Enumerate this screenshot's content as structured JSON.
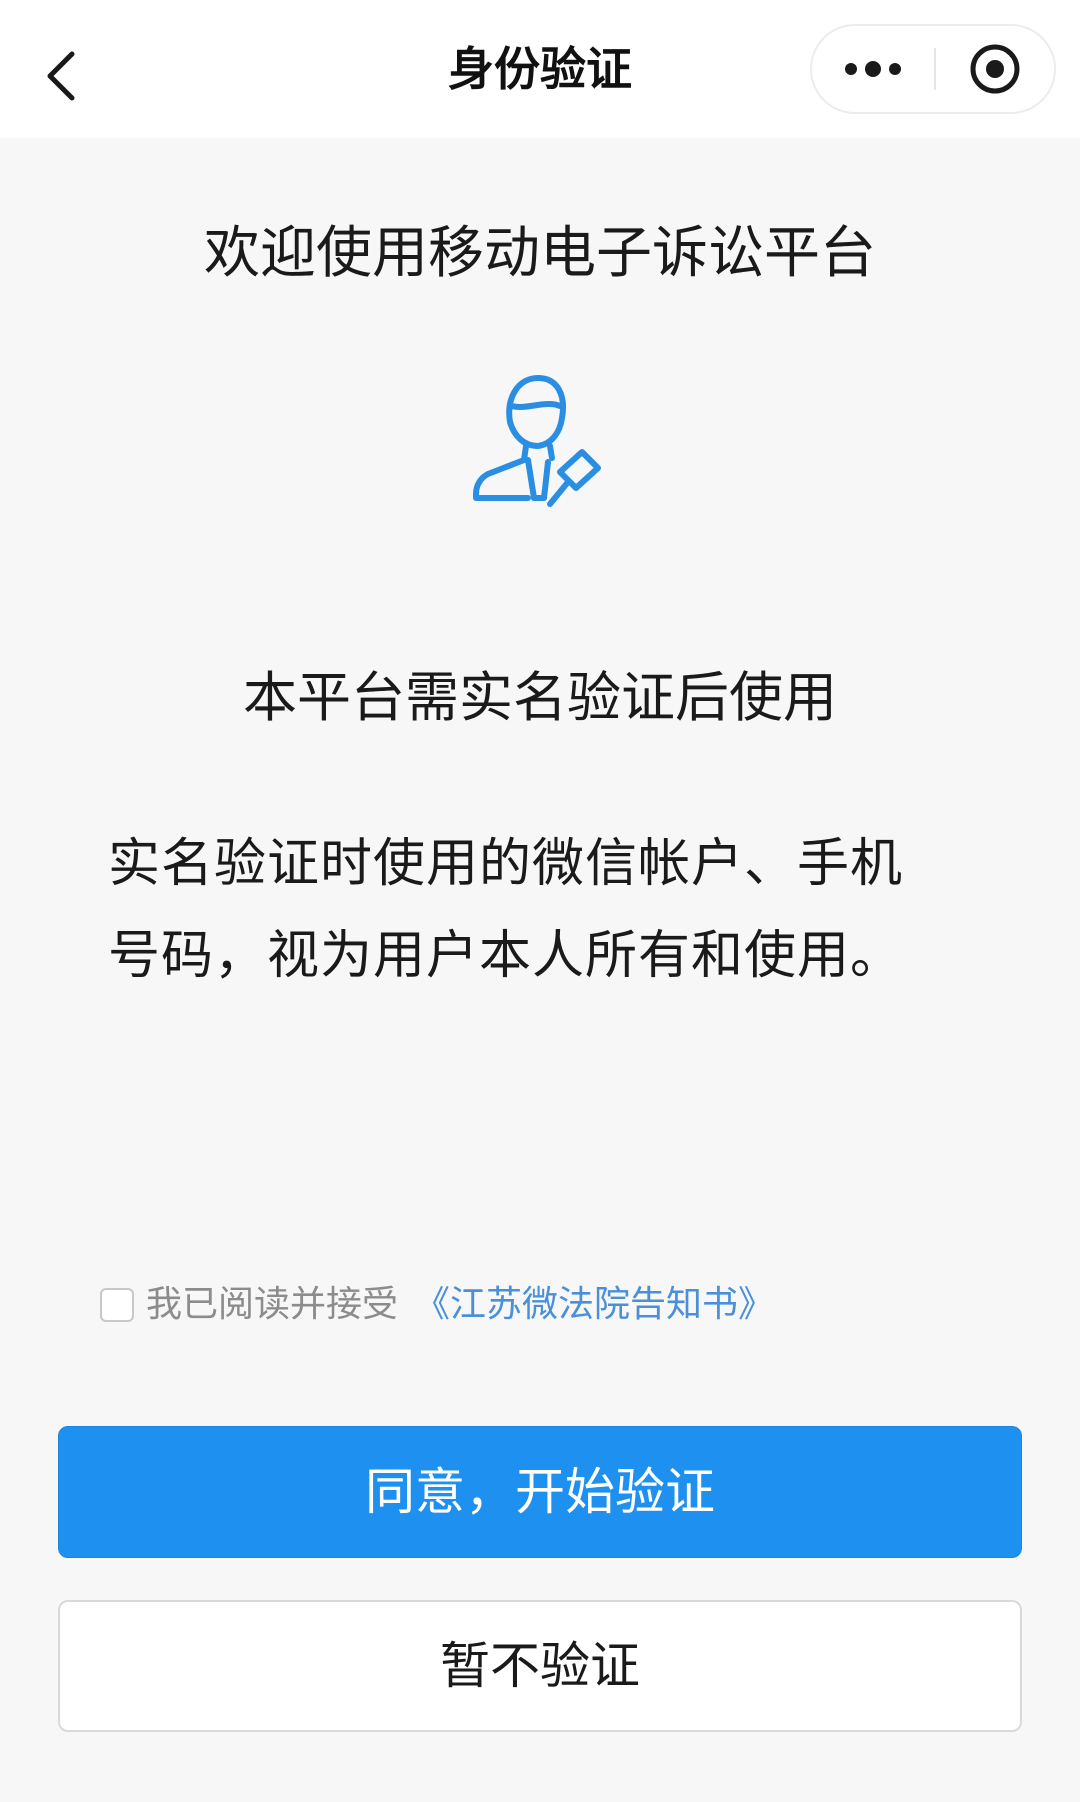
{
  "nav": {
    "title": "身份验证"
  },
  "welcome": {
    "title": "欢迎使用移动电子诉讼平台"
  },
  "notice": {
    "heading": "本平台需实名验证后使用",
    "body": "实名验证时使用的微信帐户、手机号码，视为用户本人所有和使用。"
  },
  "agreement": {
    "checked": false,
    "text": "我已阅读并接受",
    "link": "《江苏微法院告知书》"
  },
  "buttons": {
    "agree_start": "同意，开始验证",
    "skip": "暂不验证"
  },
  "icons": {
    "back": "chevron-left-icon",
    "more": "more-dots-icon",
    "close": "target-circle-icon",
    "judge": "judge-gavel-icon"
  },
  "colors": {
    "primary": "#1e90f0",
    "link": "#4a90d9",
    "icon": "#2a8ee3",
    "background": "#f7f7f7"
  }
}
